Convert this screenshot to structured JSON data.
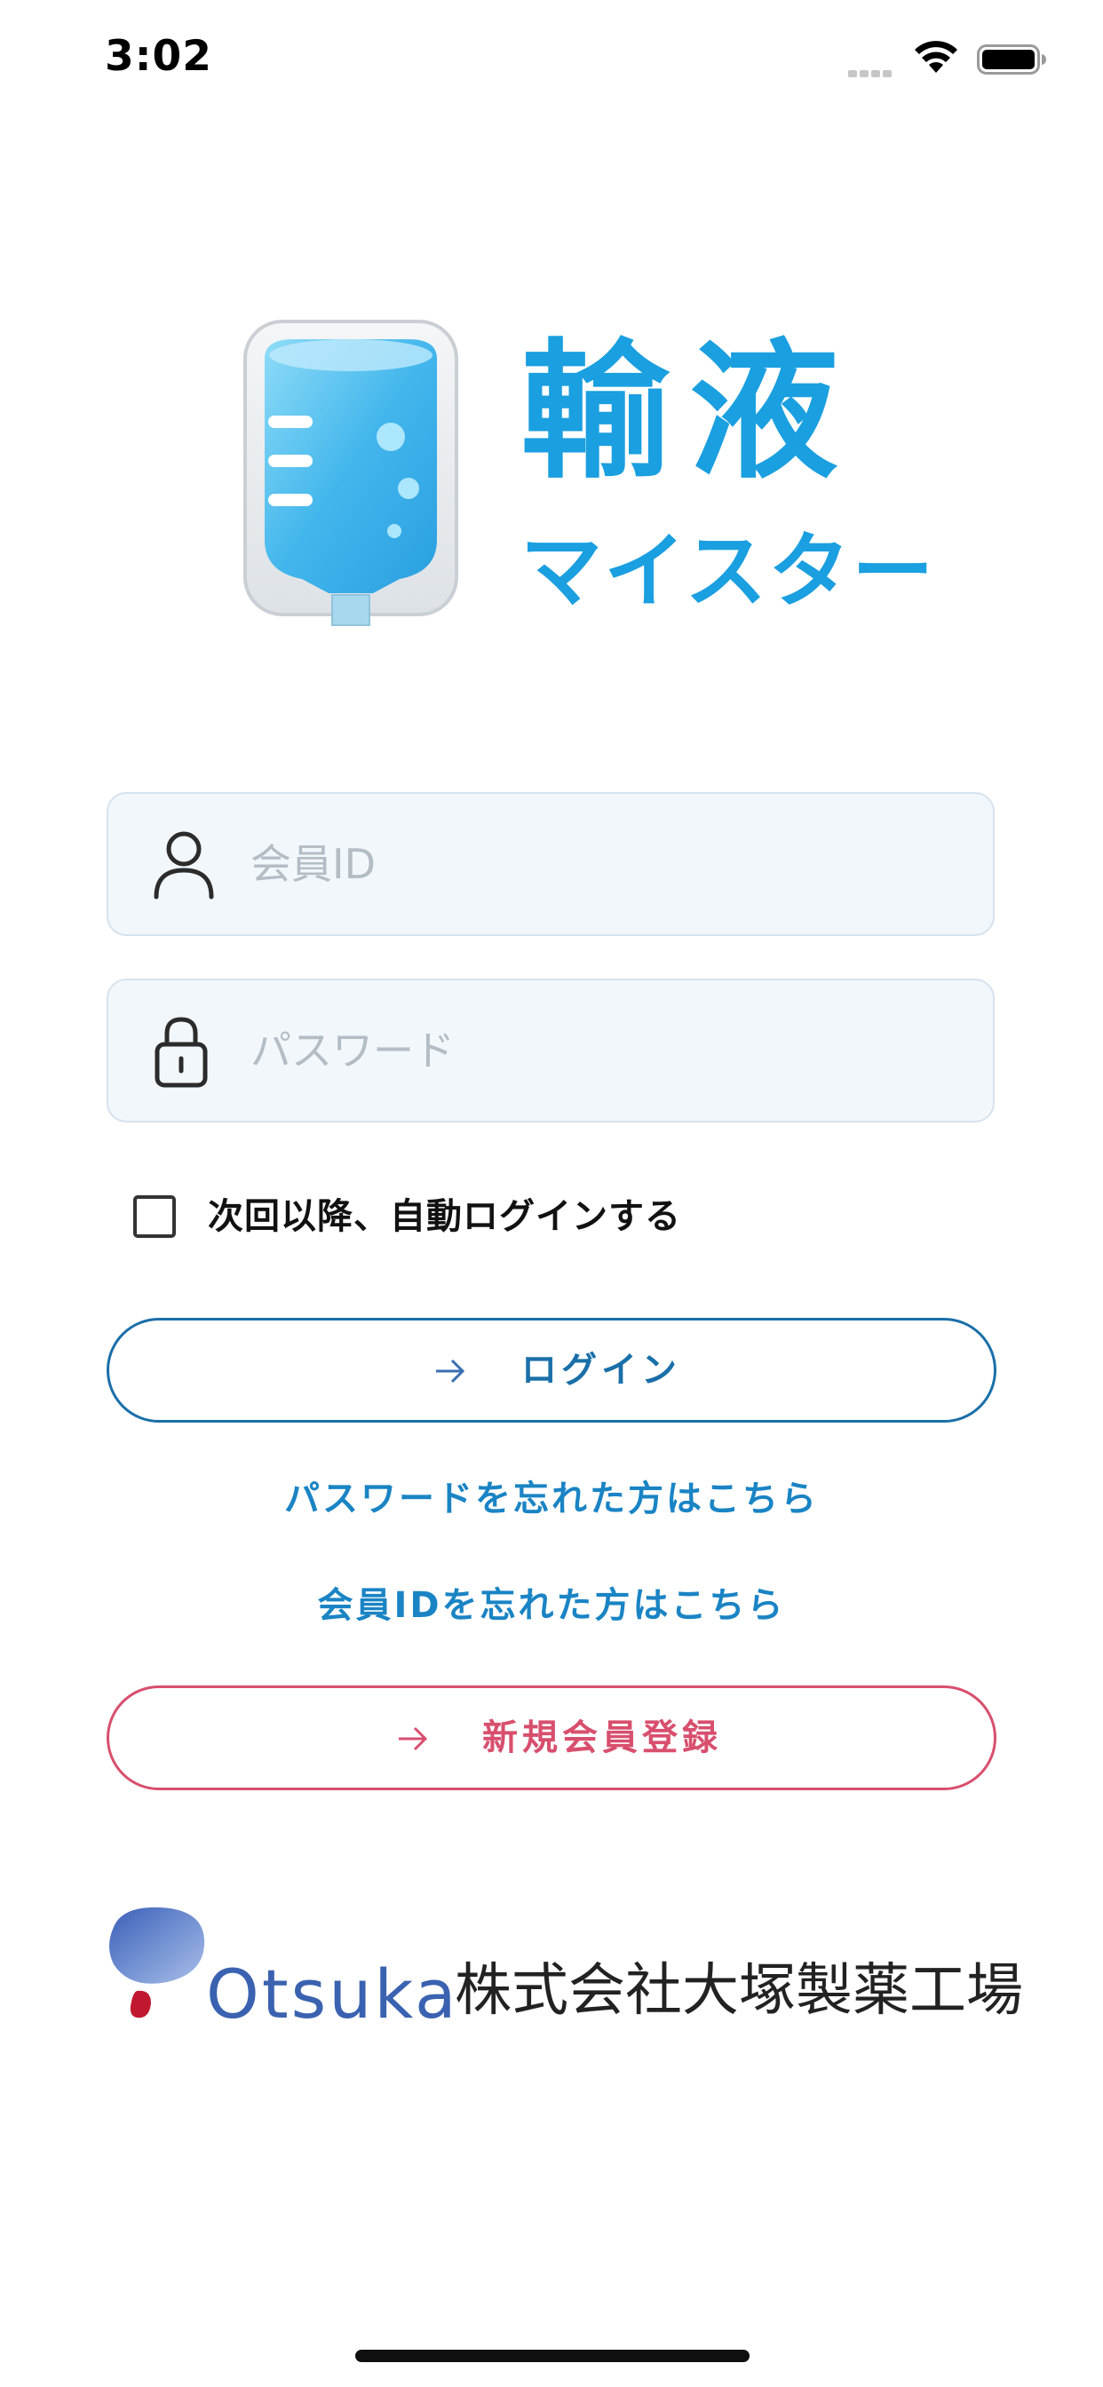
{
  "status_bar": {
    "time": "3:02",
    "signal_icon": "cellular-signal-icon",
    "wifi_icon": "wifi-icon",
    "battery_icon": "battery-icon"
  },
  "logo": {
    "title": "輸液",
    "subtitle": "マイスター",
    "icon": "iv-bag-icon",
    "color": "#1a9fe0"
  },
  "form": {
    "member_id": {
      "placeholder": "会員ID",
      "value": "",
      "icon": "user-icon"
    },
    "password": {
      "placeholder": "パスワード",
      "value": "",
      "icon": "lock-icon"
    },
    "auto_login": {
      "label": "次回以降、自動ログインする",
      "checked": false
    }
  },
  "actions": {
    "login_label": "ログイン",
    "login_color": "#1a6fa8",
    "forgot_password_link": "パスワードを忘れた方はこちら",
    "forgot_id_link": "会員IDを忘れた方はこちら",
    "register_label": "新規会員登録",
    "register_color": "#d84f6e",
    "arrow_icon": "arrow-right-icon"
  },
  "footer": {
    "brand": "Otsuka",
    "company": "株式会社大塚製薬工場",
    "brand_color": "#3a62b0"
  }
}
